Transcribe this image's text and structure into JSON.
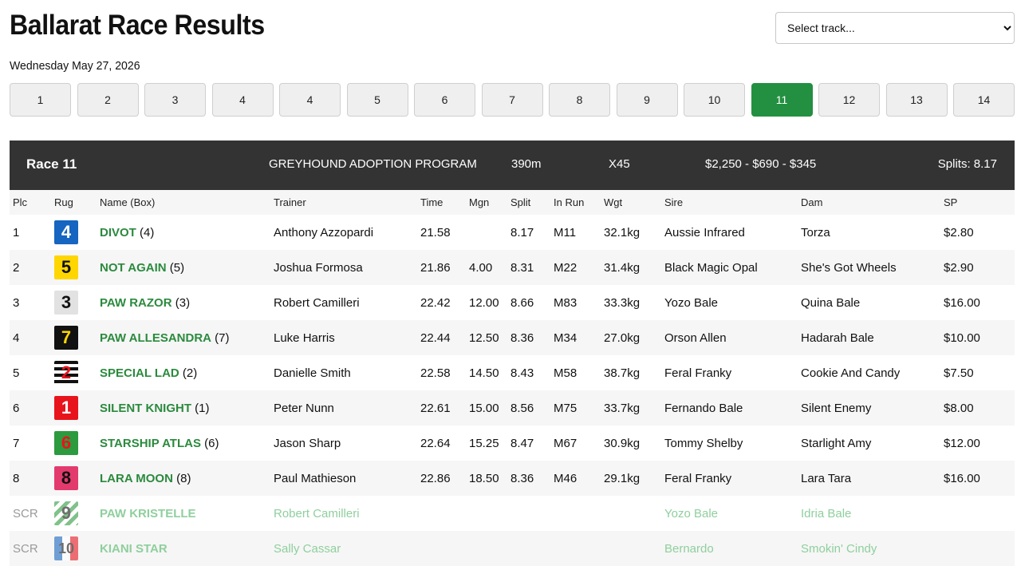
{
  "header": {
    "title": "Ballarat Race Results",
    "date": "Wednesday May 27, 2026",
    "track_select_placeholder": "Select track..."
  },
  "race_nav": {
    "active": "11",
    "buttons": [
      "1",
      "2",
      "3",
      "4",
      "4",
      "5",
      "6",
      "7",
      "8",
      "9",
      "10",
      "11",
      "12",
      "13",
      "14"
    ]
  },
  "race": {
    "label": "Race 11",
    "name": "GREYHOUND ADOPTION PROGRAM",
    "distance": "390m",
    "grade": "X45",
    "prizes": "$2,250 - $690 - $345",
    "splits": "Splits: 8.17"
  },
  "columns": [
    "Plc",
    "Rug",
    "Name (Box)",
    "Trainer",
    "Time",
    "Mgn",
    "Split",
    "In Run",
    "Wgt",
    "Sire",
    "Dam",
    "SP"
  ],
  "runners": [
    {
      "plc": "1",
      "rug": "4",
      "name": "DIVOT",
      "box": "(4)",
      "trainer": "Anthony Azzopardi",
      "time": "21.58",
      "mgn": "",
      "split": "8.17",
      "in_run": "M11",
      "wgt": "32.1kg",
      "sire": "Aussie Infrared",
      "dam": "Torza",
      "sp": "$2.80"
    },
    {
      "plc": "2",
      "rug": "5",
      "name": "NOT AGAIN",
      "box": "(5)",
      "trainer": "Joshua Formosa",
      "time": "21.86",
      "mgn": "4.00",
      "split": "8.31",
      "in_run": "M22",
      "wgt": "31.4kg",
      "sire": "Black Magic Opal",
      "dam": "She's Got Wheels",
      "sp": "$2.90"
    },
    {
      "plc": "3",
      "rug": "3",
      "name": "PAW RAZOR",
      "box": "(3)",
      "trainer": "Robert Camilleri",
      "time": "22.42",
      "mgn": "12.00",
      "split": "8.66",
      "in_run": "M83",
      "wgt": "33.3kg",
      "sire": "Yozo Bale",
      "dam": "Quina Bale",
      "sp": "$16.00"
    },
    {
      "plc": "4",
      "rug": "7",
      "name": "PAW ALLESANDRA",
      "box": "(7)",
      "trainer": "Luke Harris",
      "time": "22.44",
      "mgn": "12.50",
      "split": "8.36",
      "in_run": "M34",
      "wgt": "27.0kg",
      "sire": "Orson Allen",
      "dam": "Hadarah Bale",
      "sp": "$10.00"
    },
    {
      "plc": "5",
      "rug": "2",
      "name": "SPECIAL LAD",
      "box": "(2)",
      "trainer": "Danielle Smith",
      "time": "22.58",
      "mgn": "14.50",
      "split": "8.43",
      "in_run": "M58",
      "wgt": "38.7kg",
      "sire": "Feral Franky",
      "dam": "Cookie And Candy",
      "sp": "$7.50"
    },
    {
      "plc": "6",
      "rug": "1",
      "name": "SILENT KNIGHT",
      "box": "(1)",
      "trainer": "Peter Nunn",
      "time": "22.61",
      "mgn": "15.00",
      "split": "8.56",
      "in_run": "M75",
      "wgt": "33.7kg",
      "sire": "Fernando Bale",
      "dam": "Silent Enemy",
      "sp": "$8.00"
    },
    {
      "plc": "7",
      "rug": "6",
      "name": "STARSHIP ATLAS",
      "box": "(6)",
      "trainer": "Jason Sharp",
      "time": "22.64",
      "mgn": "15.25",
      "split": "8.47",
      "in_run": "M67",
      "wgt": "30.9kg",
      "sire": "Tommy Shelby",
      "dam": "Starlight Amy",
      "sp": "$12.00"
    },
    {
      "plc": "8",
      "rug": "8",
      "name": "LARA MOON",
      "box": "(8)",
      "trainer": "Paul Mathieson",
      "time": "22.86",
      "mgn": "18.50",
      "split": "8.36",
      "in_run": "M46",
      "wgt": "29.1kg",
      "sire": "Feral Franky",
      "dam": "Lara Tara",
      "sp": "$16.00"
    },
    {
      "plc": "SCR",
      "rug": "9",
      "name": "PAW KRISTELLE",
      "box": "",
      "trainer": "Robert Camilleri",
      "time": "",
      "mgn": "",
      "split": "",
      "in_run": "",
      "wgt": "",
      "sire": "Yozo Bale",
      "dam": "Idria Bale",
      "sp": ""
    },
    {
      "plc": "SCR",
      "rug": "10",
      "name": "KIANI STAR",
      "box": "",
      "trainer": "Sally Cassar",
      "time": "",
      "mgn": "",
      "split": "",
      "in_run": "",
      "wgt": "",
      "sire": "Bernardo",
      "dam": "Smokin' Cindy",
      "sp": ""
    }
  ]
}
